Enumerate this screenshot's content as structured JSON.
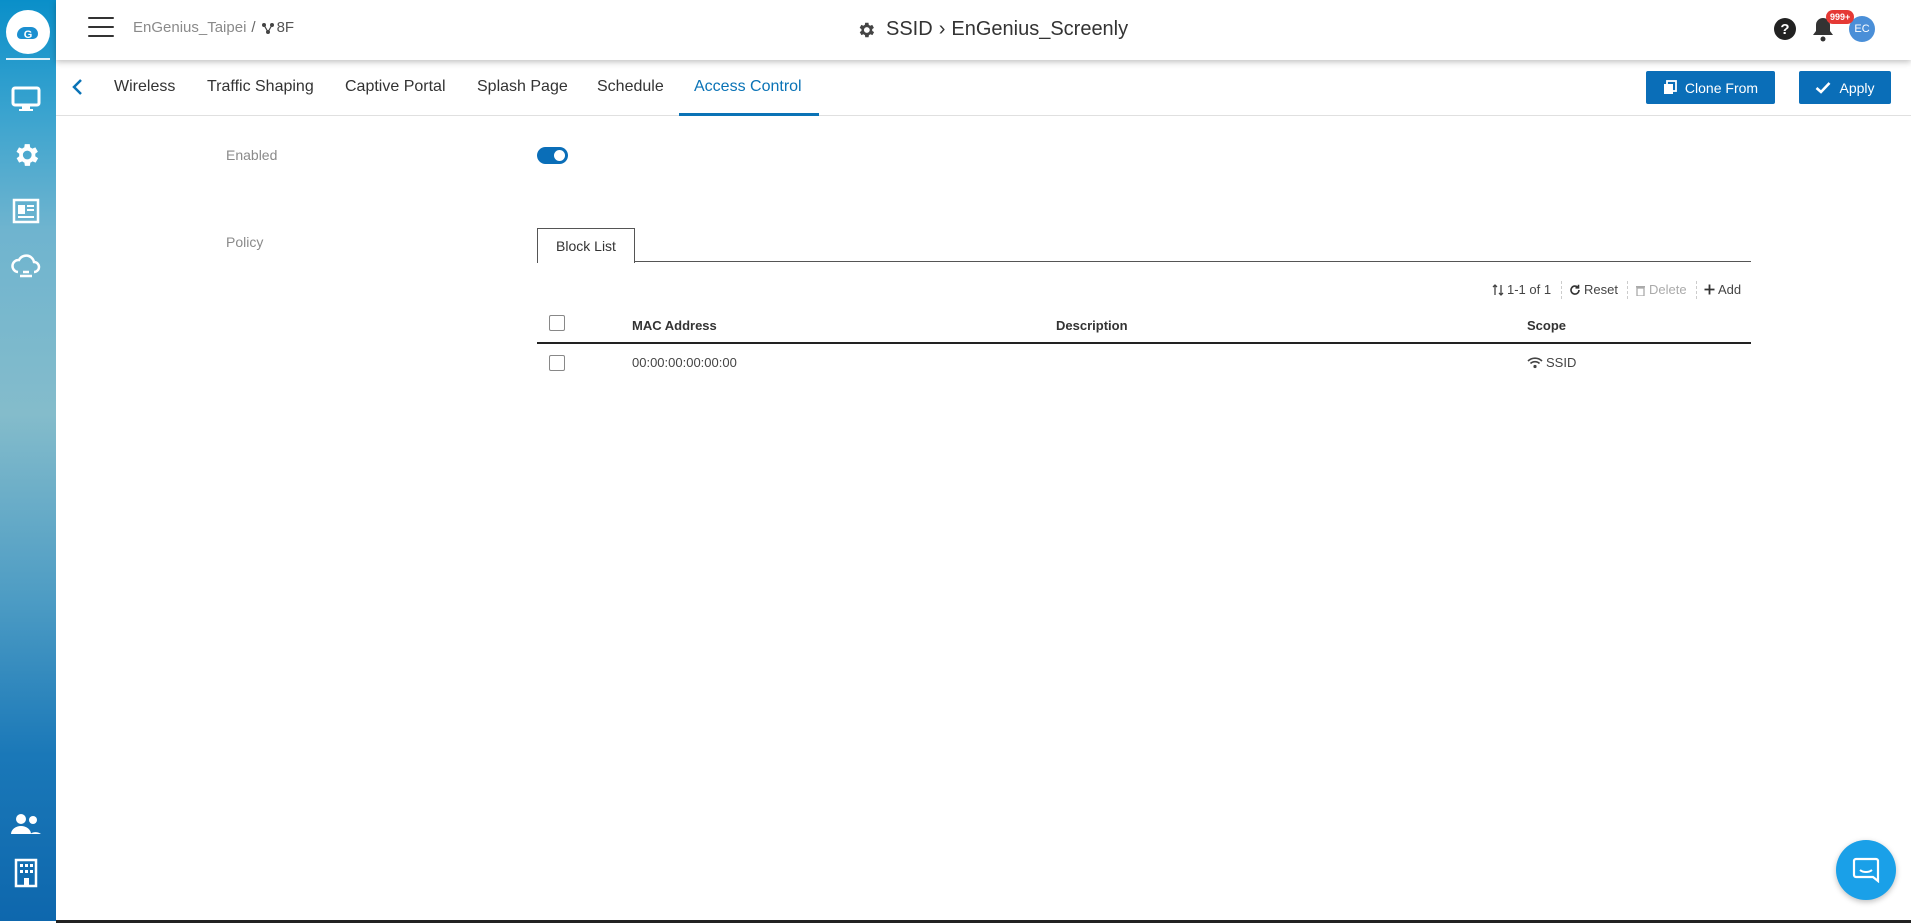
{
  "header": {
    "org": "EnGenius_Taipei",
    "separator": "/",
    "floor": "8F",
    "title_prefix": "SSID",
    "title_arrow": "›",
    "title_name": "EnGenius_Screenly",
    "notification_count": "999+",
    "avatar_initials": "EC"
  },
  "tabs": [
    {
      "label": "Wireless"
    },
    {
      "label": "Traffic Shaping"
    },
    {
      "label": "Captive Portal"
    },
    {
      "label": "Splash Page"
    },
    {
      "label": "Schedule"
    },
    {
      "label": "Access Control",
      "active": true
    }
  ],
  "buttons": {
    "clone_from": "Clone From",
    "apply": "Apply"
  },
  "form": {
    "enabled_label": "Enabled",
    "enabled_value": true,
    "policy_label": "Policy",
    "policy_tab": "Block List"
  },
  "toolbar": {
    "pagination": "1-1 of 1",
    "reset": "Reset",
    "delete": "Delete",
    "add": "Add"
  },
  "table": {
    "columns": [
      "MAC Address",
      "Description",
      "Scope"
    ],
    "rows": [
      {
        "mac": "00:00:00:00:00:00",
        "description": "",
        "scope": "SSID"
      }
    ]
  },
  "colors": {
    "accent": "#0a6eb8",
    "active_tab": "#0a73b6",
    "badge": "#e53935",
    "chat": "#1aa0e8"
  },
  "icons": {
    "sidebar": [
      "monitor-icon",
      "gear-icon",
      "report-icon",
      "cloud-icon",
      "users-icon",
      "building-icon"
    ]
  }
}
